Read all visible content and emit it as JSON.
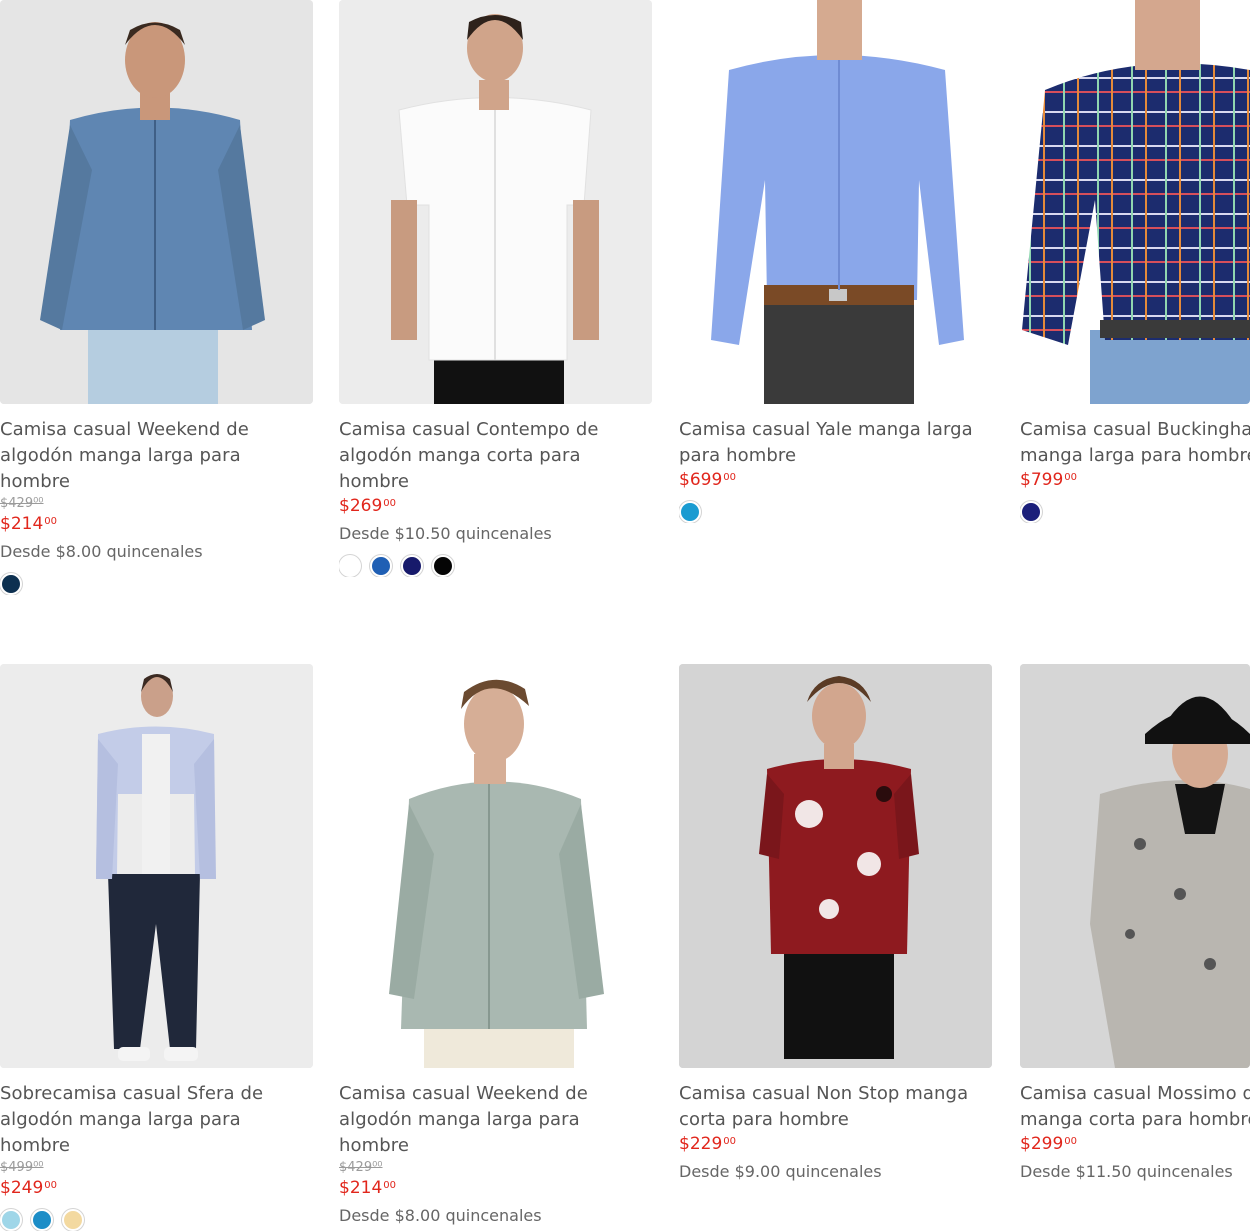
{
  "products": [
    {
      "title": "Camisa casual Weekend de algodón manga larga para hombre",
      "old_price": "$429⁰⁰",
      "price": "$214",
      "price_cents": "00",
      "installments": "Desde $8.00 quincenales",
      "swatches": [
        "#0d3050"
      ]
    },
    {
      "title": "Camisa casual Contempo de algodón manga corta para hombre",
      "old_price": "",
      "price": "$269",
      "price_cents": "00",
      "installments": "Desde $10.50 quincenales",
      "swatches": [
        "#ffffff",
        "#1f5fb4",
        "#171a6b",
        "#050505"
      ]
    },
    {
      "title": "Camisa casual Yale manga larga para hombre",
      "old_price": "",
      "price": "$699",
      "price_cents": "00",
      "installments": "",
      "swatches": [
        "#1a9bd1"
      ]
    },
    {
      "title": "Camisa casual Buckingham de algodón manga larga para hombre",
      "old_price": "",
      "price": "$799",
      "price_cents": "00",
      "installments": "",
      "swatches": [
        "#1b1f7a"
      ]
    },
    {
      "title": "Sobrecamisa casual Sfera de algodón manga larga para hombre",
      "old_price": "$499⁰⁰",
      "price": "$249",
      "price_cents": "00",
      "installments": "",
      "swatches": [
        "#9fd6e8",
        "#1c8dc7",
        "#f3d9a0"
      ]
    },
    {
      "title": "Camisa casual Weekend de algodón manga larga para hombre",
      "old_price": "$429⁰⁰",
      "price": "$214",
      "price_cents": "00",
      "installments": "Desde $8.00 quincenales",
      "swatches": []
    },
    {
      "title": "Camisa casual Non Stop manga corta para hombre",
      "old_price": "",
      "price": "$229",
      "price_cents": "00",
      "installments": "Desde $9.00 quincenales",
      "swatches": []
    },
    {
      "title": "Camisa casual Mossimo de algodón manga corta para hombre",
      "old_price": "",
      "price": "$299",
      "price_cents": "00",
      "installments": "Desde $11.50 quincenales",
      "swatches": []
    }
  ],
  "colors": {
    "price_red": "#e1261c",
    "text_gray": "#555555"
  }
}
